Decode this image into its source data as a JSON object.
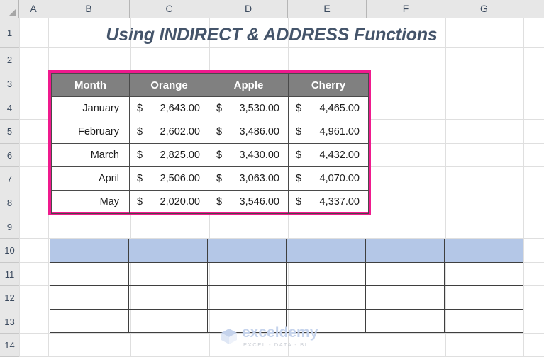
{
  "spreadsheet": {
    "column_headers": [
      "A",
      "B",
      "C",
      "D",
      "E",
      "F",
      "G"
    ],
    "row_headers": [
      "1",
      "2",
      "3",
      "4",
      "5",
      "6",
      "7",
      "8",
      "9",
      "10",
      "11",
      "12",
      "13",
      "14"
    ],
    "title": "Using INDIRECT & ADDRESS Functions",
    "title_color": "#44546a"
  },
  "data_table": {
    "border_color": "#f01a8e",
    "header_bg": "#808080",
    "header_text_color": "#ffffff",
    "headers": [
      "Month",
      "Orange",
      "Apple",
      "Cherry"
    ],
    "rows": [
      {
        "month": "January",
        "orange_sym": "$",
        "orange": "2,643.00",
        "apple_sym": "$",
        "apple": "3,530.00",
        "cherry_sym": "$",
        "cherry": "4,465.00"
      },
      {
        "month": "February",
        "orange_sym": "$",
        "orange": "2,602.00",
        "apple_sym": "$",
        "apple": "3,486.00",
        "cherry_sym": "$",
        "cherry": "4,961.00"
      },
      {
        "month": "March",
        "orange_sym": "$",
        "orange": "2,825.00",
        "apple_sym": "$",
        "apple": "3,430.00",
        "cherry_sym": "$",
        "cherry": "4,432.00"
      },
      {
        "month": "April",
        "orange_sym": "$",
        "orange": "2,506.00",
        "apple_sym": "$",
        "apple": "3,063.00",
        "cherry_sym": "$",
        "cherry": "4,070.00"
      },
      {
        "month": "May",
        "orange_sym": "$",
        "orange": "2,020.00",
        "apple_sym": "$",
        "apple": "3,546.00",
        "cherry_sym": "$",
        "cherry": "4,337.00"
      }
    ]
  },
  "blank_table": {
    "header_bg": "#b4c7e7",
    "columns": 6,
    "body_rows": 3,
    "cells": [
      "",
      "",
      "",
      "",
      "",
      ""
    ]
  },
  "watermark": {
    "name": "exceldemy",
    "tagline": "EXCEL - DATA - BI",
    "color": "#c5d3ec"
  }
}
